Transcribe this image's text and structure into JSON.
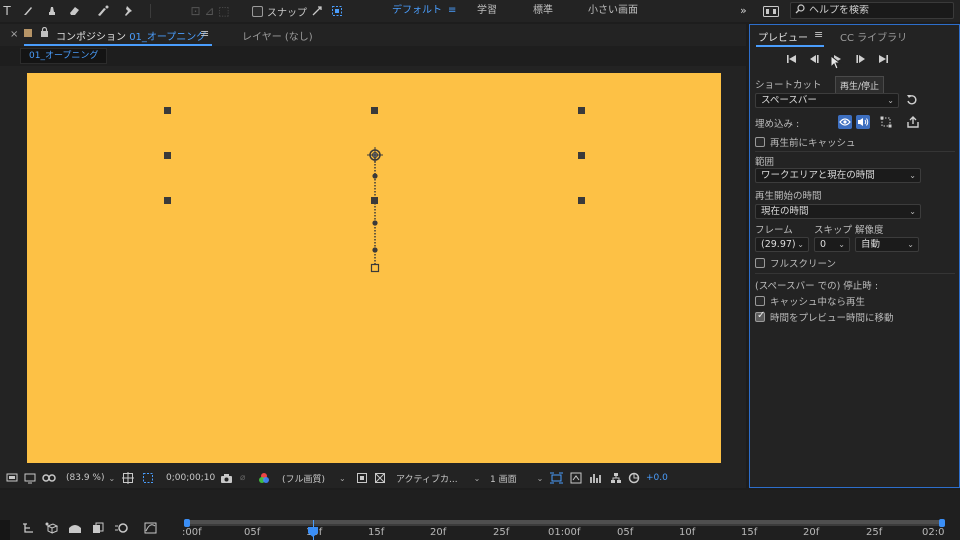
{
  "toolbar": {
    "snap_label": "スナップ",
    "workspaces": [
      {
        "label": "デフォルト",
        "active": true
      },
      {
        "label": "学習",
        "active": false
      },
      {
        "label": "標準",
        "active": false
      },
      {
        "label": "小さい画面",
        "active": false
      }
    ],
    "search_placeholder": "ヘルプを検索",
    "icons": [
      "text-tool-icon",
      "brush-tool-icon",
      "clone-stamp-icon",
      "eraser-tool-icon",
      "roto-brush-icon",
      "puppet-pin-icon",
      "snap-checkbox",
      "snap-icon",
      "workspace-menu-icon",
      "expand-icon",
      "panel-switch-icon",
      "search-icon"
    ]
  },
  "composition": {
    "tab_label_prefix": "コンポジション",
    "tab_label_name": "01_オープニング",
    "layer_tab": "レイヤー (なし)",
    "breadcrumb": "01_オープニング",
    "canvas_color": "#fdc145"
  },
  "viewer_footer": {
    "zoom": "(83.9 %)",
    "timecode": "0;00;00;10",
    "resolution": "(フル画質)",
    "camera": "アクティブカ...",
    "views": "1 画面",
    "exposure": "+0.0"
  },
  "preview": {
    "tab_preview": "プレビュー",
    "tab_library": "CC ライブラリ",
    "tooltip": "再生/停止",
    "shortcut_label": "ショートカット",
    "shortcut_value": "スペースバー",
    "embed_label": "埋め込み :",
    "cache_before": "再生前にキャッシュ",
    "range_label": "範囲",
    "range_value": "ワークエリアと現在の時間",
    "start_label": "再生開始の時間",
    "start_value": "現在の時間",
    "frame_label": "フレーム",
    "skip_label": "スキップ",
    "res_label": "解像度",
    "frame_value": "(29.97)",
    "skip_value": "0",
    "res_value": "自動",
    "fullscreen": "フルスクリーン",
    "on_stop_label": "(スペースバー での) 停止時 :",
    "play_if_caching": "キャッシュ中なら再生",
    "move_time": "時間をプレビュー時間に移動",
    "move_time_checked": true
  },
  "timeline": {
    "ticks": [
      ":00f",
      "05f",
      "10f",
      "15f",
      "20f",
      "25f",
      "01:00f",
      "05f",
      "10f",
      "15f",
      "20f",
      "25f",
      "02:0"
    ],
    "accent": "#3a8ef6"
  }
}
